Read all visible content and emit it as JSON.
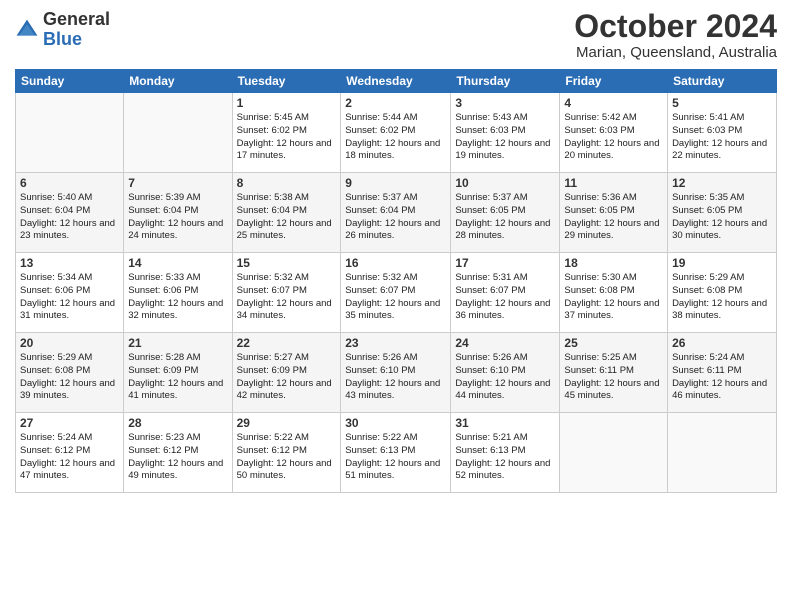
{
  "logo": {
    "general": "General",
    "blue": "Blue"
  },
  "header": {
    "month": "October 2024",
    "location": "Marian, Queensland, Australia"
  },
  "days_of_week": [
    "Sunday",
    "Monday",
    "Tuesday",
    "Wednesday",
    "Thursday",
    "Friday",
    "Saturday"
  ],
  "weeks": [
    [
      {
        "day": "",
        "info": ""
      },
      {
        "day": "",
        "info": ""
      },
      {
        "day": "1",
        "info": "Sunrise: 5:45 AM\nSunset: 6:02 PM\nDaylight: 12 hours and 17 minutes."
      },
      {
        "day": "2",
        "info": "Sunrise: 5:44 AM\nSunset: 6:02 PM\nDaylight: 12 hours and 18 minutes."
      },
      {
        "day": "3",
        "info": "Sunrise: 5:43 AM\nSunset: 6:03 PM\nDaylight: 12 hours and 19 minutes."
      },
      {
        "day": "4",
        "info": "Sunrise: 5:42 AM\nSunset: 6:03 PM\nDaylight: 12 hours and 20 minutes."
      },
      {
        "day": "5",
        "info": "Sunrise: 5:41 AM\nSunset: 6:03 PM\nDaylight: 12 hours and 22 minutes."
      }
    ],
    [
      {
        "day": "6",
        "info": "Sunrise: 5:40 AM\nSunset: 6:04 PM\nDaylight: 12 hours and 23 minutes."
      },
      {
        "day": "7",
        "info": "Sunrise: 5:39 AM\nSunset: 6:04 PM\nDaylight: 12 hours and 24 minutes."
      },
      {
        "day": "8",
        "info": "Sunrise: 5:38 AM\nSunset: 6:04 PM\nDaylight: 12 hours and 25 minutes."
      },
      {
        "day": "9",
        "info": "Sunrise: 5:37 AM\nSunset: 6:04 PM\nDaylight: 12 hours and 26 minutes."
      },
      {
        "day": "10",
        "info": "Sunrise: 5:37 AM\nSunset: 6:05 PM\nDaylight: 12 hours and 28 minutes."
      },
      {
        "day": "11",
        "info": "Sunrise: 5:36 AM\nSunset: 6:05 PM\nDaylight: 12 hours and 29 minutes."
      },
      {
        "day": "12",
        "info": "Sunrise: 5:35 AM\nSunset: 6:05 PM\nDaylight: 12 hours and 30 minutes."
      }
    ],
    [
      {
        "day": "13",
        "info": "Sunrise: 5:34 AM\nSunset: 6:06 PM\nDaylight: 12 hours and 31 minutes."
      },
      {
        "day": "14",
        "info": "Sunrise: 5:33 AM\nSunset: 6:06 PM\nDaylight: 12 hours and 32 minutes."
      },
      {
        "day": "15",
        "info": "Sunrise: 5:32 AM\nSunset: 6:07 PM\nDaylight: 12 hours and 34 minutes."
      },
      {
        "day": "16",
        "info": "Sunrise: 5:32 AM\nSunset: 6:07 PM\nDaylight: 12 hours and 35 minutes."
      },
      {
        "day": "17",
        "info": "Sunrise: 5:31 AM\nSunset: 6:07 PM\nDaylight: 12 hours and 36 minutes."
      },
      {
        "day": "18",
        "info": "Sunrise: 5:30 AM\nSunset: 6:08 PM\nDaylight: 12 hours and 37 minutes."
      },
      {
        "day": "19",
        "info": "Sunrise: 5:29 AM\nSunset: 6:08 PM\nDaylight: 12 hours and 38 minutes."
      }
    ],
    [
      {
        "day": "20",
        "info": "Sunrise: 5:29 AM\nSunset: 6:08 PM\nDaylight: 12 hours and 39 minutes."
      },
      {
        "day": "21",
        "info": "Sunrise: 5:28 AM\nSunset: 6:09 PM\nDaylight: 12 hours and 41 minutes."
      },
      {
        "day": "22",
        "info": "Sunrise: 5:27 AM\nSunset: 6:09 PM\nDaylight: 12 hours and 42 minutes."
      },
      {
        "day": "23",
        "info": "Sunrise: 5:26 AM\nSunset: 6:10 PM\nDaylight: 12 hours and 43 minutes."
      },
      {
        "day": "24",
        "info": "Sunrise: 5:26 AM\nSunset: 6:10 PM\nDaylight: 12 hours and 44 minutes."
      },
      {
        "day": "25",
        "info": "Sunrise: 5:25 AM\nSunset: 6:11 PM\nDaylight: 12 hours and 45 minutes."
      },
      {
        "day": "26",
        "info": "Sunrise: 5:24 AM\nSunset: 6:11 PM\nDaylight: 12 hours and 46 minutes."
      }
    ],
    [
      {
        "day": "27",
        "info": "Sunrise: 5:24 AM\nSunset: 6:12 PM\nDaylight: 12 hours and 47 minutes."
      },
      {
        "day": "28",
        "info": "Sunrise: 5:23 AM\nSunset: 6:12 PM\nDaylight: 12 hours and 49 minutes."
      },
      {
        "day": "29",
        "info": "Sunrise: 5:22 AM\nSunset: 6:12 PM\nDaylight: 12 hours and 50 minutes."
      },
      {
        "day": "30",
        "info": "Sunrise: 5:22 AM\nSunset: 6:13 PM\nDaylight: 12 hours and 51 minutes."
      },
      {
        "day": "31",
        "info": "Sunrise: 5:21 AM\nSunset: 6:13 PM\nDaylight: 12 hours and 52 minutes."
      },
      {
        "day": "",
        "info": ""
      },
      {
        "day": "",
        "info": ""
      }
    ]
  ]
}
